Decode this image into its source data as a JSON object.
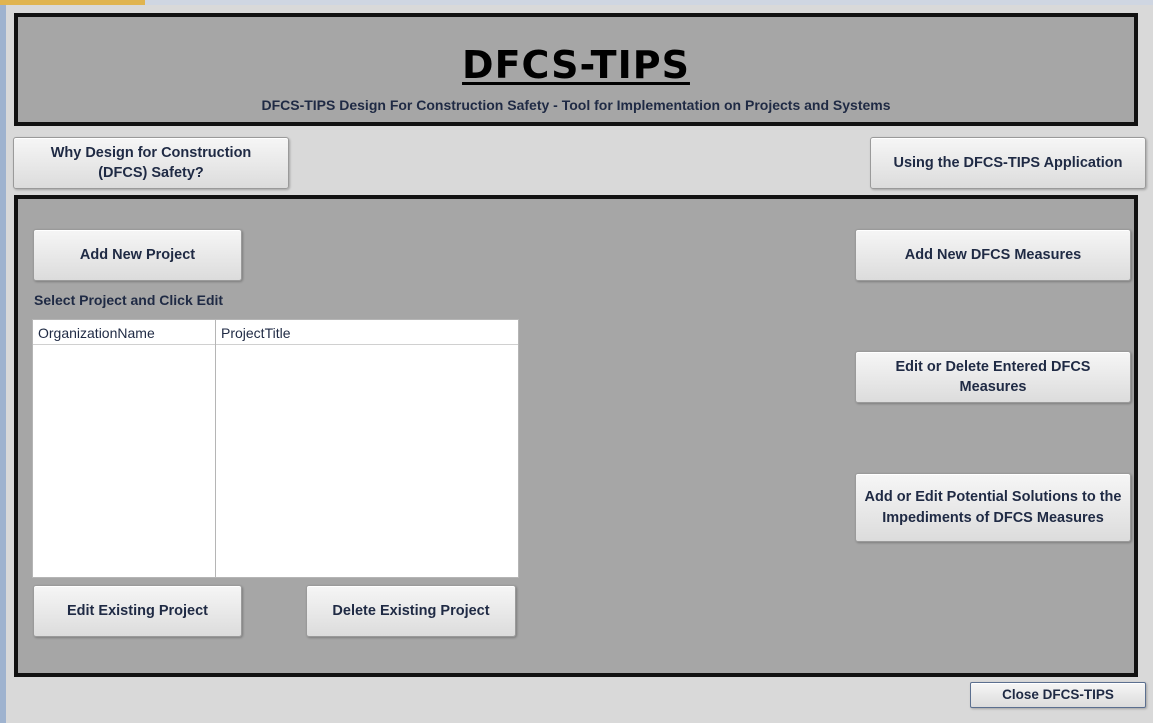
{
  "header": {
    "title": "DFCS-TIPS",
    "subtitle": "DFCS-TIPS Design For Construction Safety - Tool for Implementation on Projects and Systems"
  },
  "nav": {
    "why_dfcs": "Why Design for Construction (DFCS) Safety?",
    "using_app": "Using the DFCS-TIPS Application"
  },
  "projects": {
    "add_label": "Add New Project",
    "select_label": "Select Project and Click Edit",
    "columns": [
      "OrganizationName",
      "ProjectTitle"
    ],
    "edit_label": "Edit Existing Project",
    "delete_label": "Delete Existing Project"
  },
  "measures": {
    "add_label": "Add New DFCS Measures",
    "edit_delete_label": "Edit or Delete Entered DFCS Measures",
    "solutions_label": "Add or Edit Potential Solutions to the Impediments of DFCS Measures"
  },
  "footer": {
    "close_label": "Close DFCS-TIPS"
  },
  "colors": {
    "panel_bg": "#a6a6a6",
    "form_bg": "#d9d9d9",
    "panel_border": "#111111",
    "text": "#1f2a44"
  }
}
